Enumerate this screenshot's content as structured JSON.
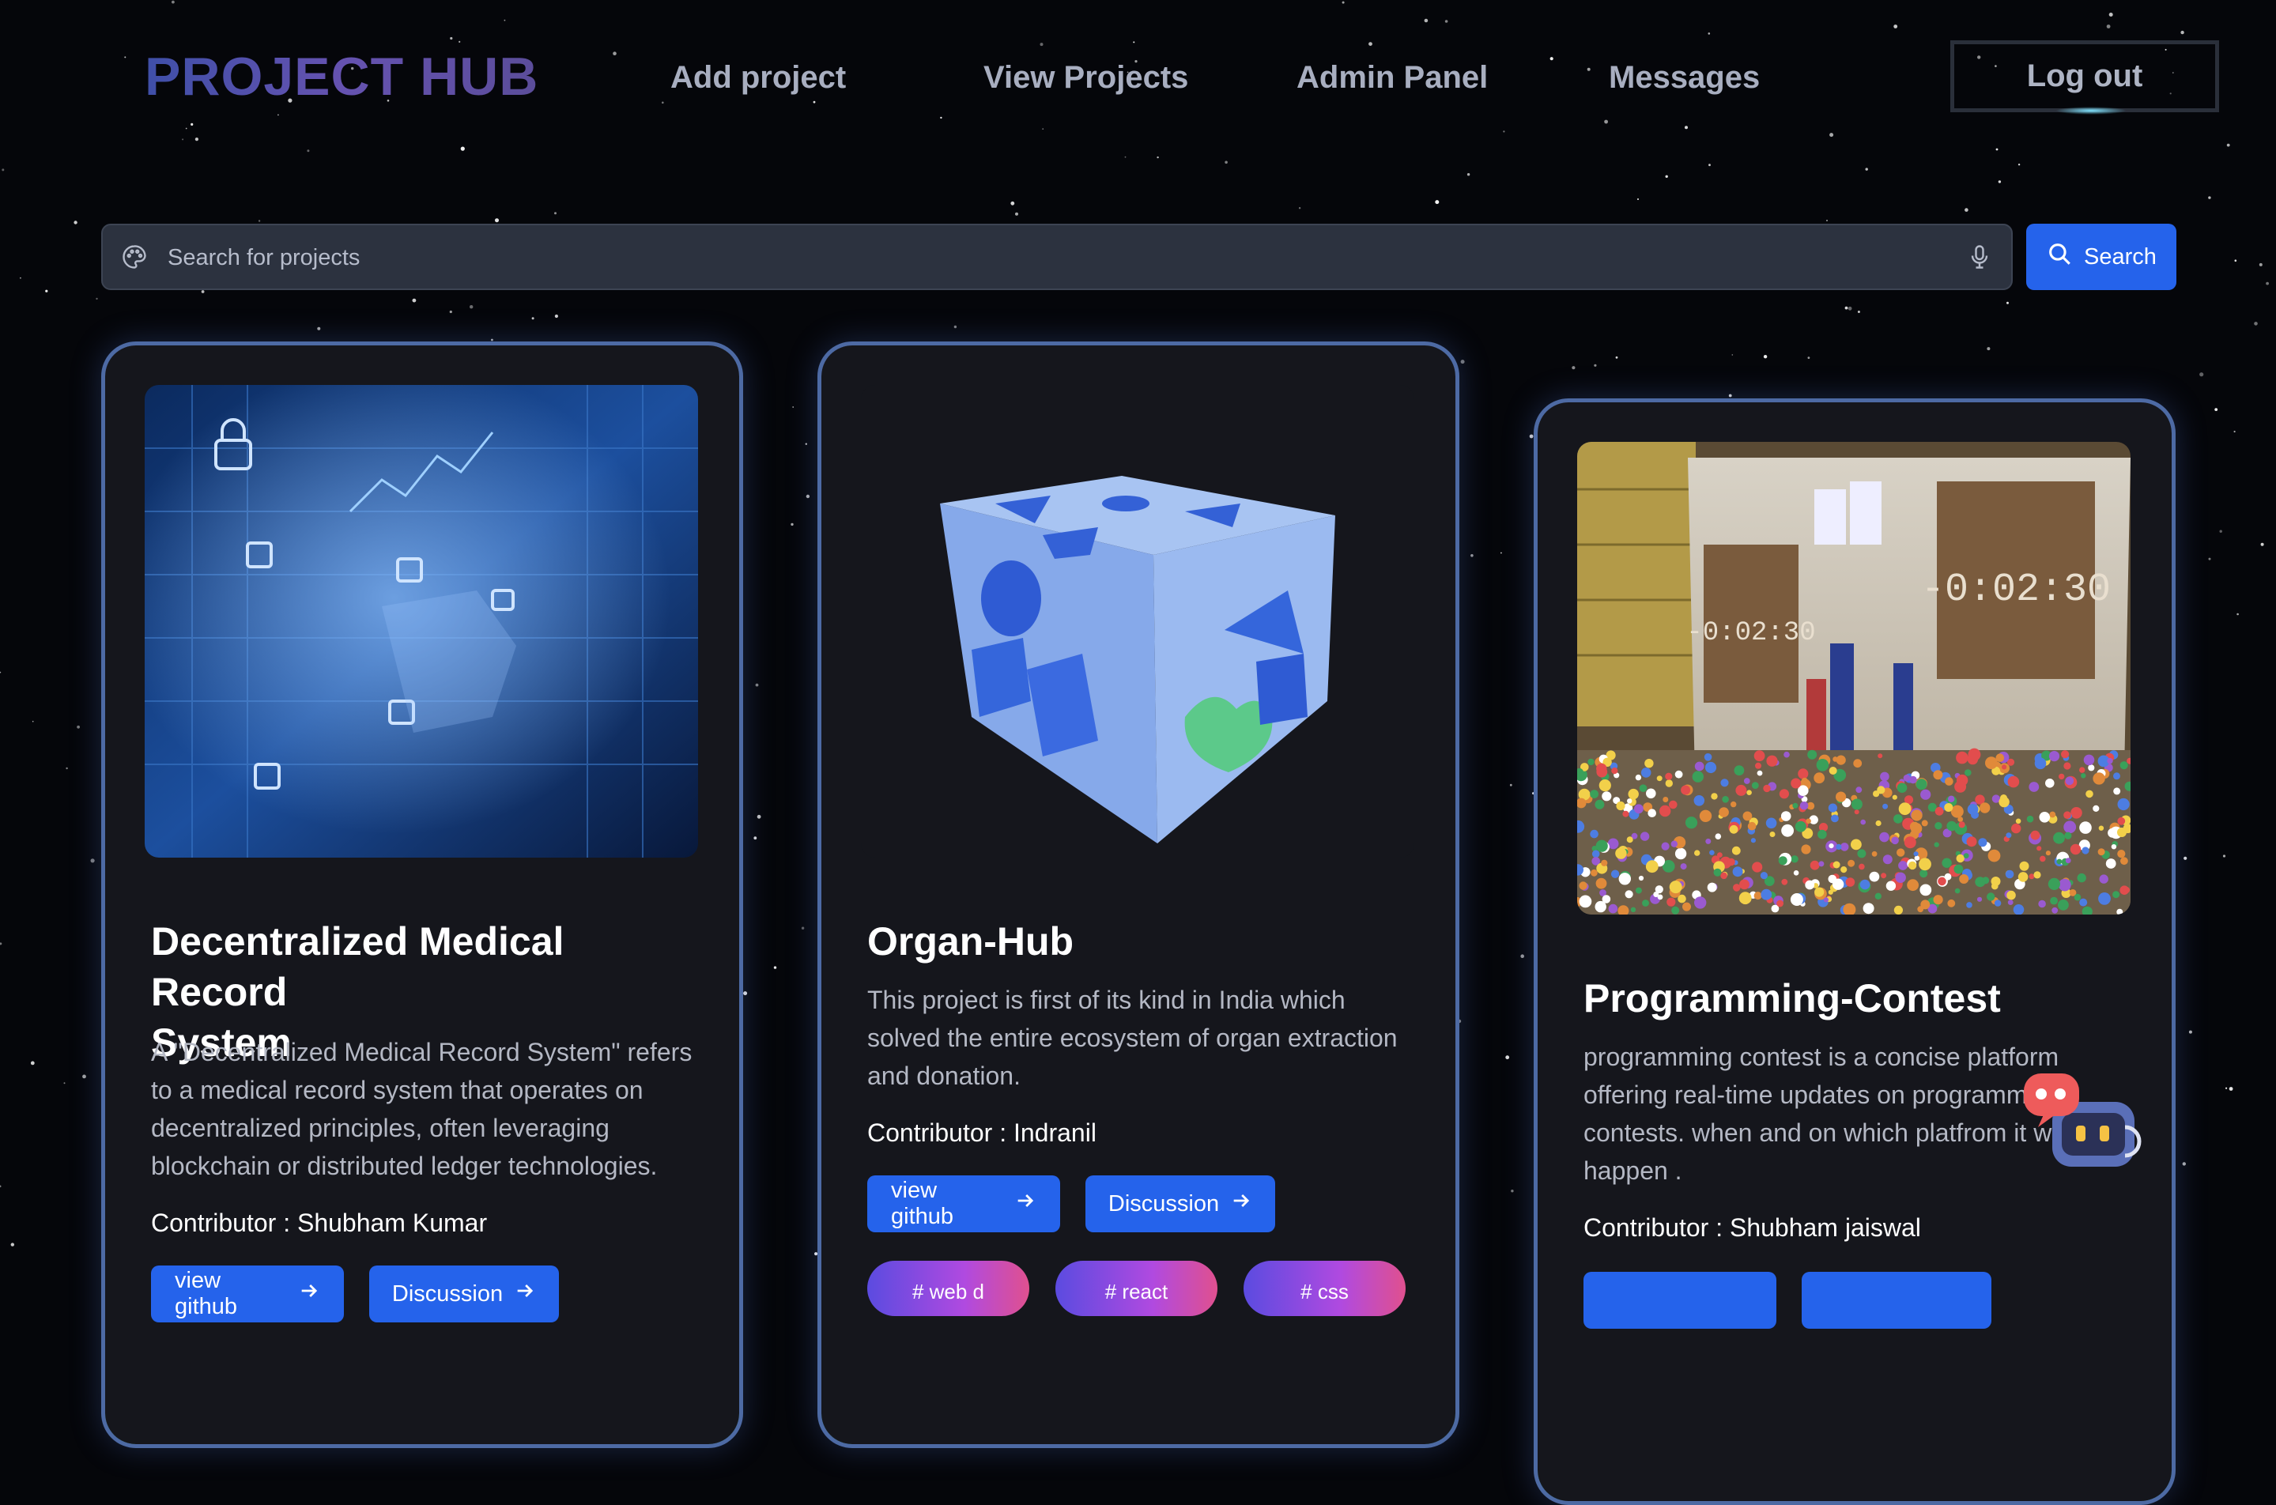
{
  "nav": {
    "brand": "PROJECT HUB",
    "links": [
      "Add project",
      "View Projects",
      "Admin Panel",
      "Messages"
    ],
    "logout": "Log out"
  },
  "search": {
    "placeholder": "Search for projects",
    "button_label": "Search"
  },
  "cards": [
    {
      "title_lines": [
        "Decentralized Medical Record",
        "System"
      ],
      "description": "A \"Decentralized Medical Record System\" refers to a medical record system that operates on decentralized principles, often leveraging blockchain or distributed ledger technologies.",
      "contributor": "Contributor : Shubham Kumar",
      "github_label": "view github",
      "discussion_label": "Discussion",
      "image": "blockchain-security-photo"
    },
    {
      "title": "Organ-Hub",
      "description": "This project is first of its kind in India which solved the entire ecosystem of organ extraction and donation.",
      "contributor": "Contributor : Indranil",
      "github_label": "view github",
      "discussion_label": "Discussion",
      "tags": [
        "# web d",
        "# react",
        "# css"
      ],
      "image": "shape-sorter-cube-3d"
    },
    {
      "title": "Programming-Contest",
      "description": "programming contest is a concise platform offering real-time updates on programming contests. when and on which platfrom it will happen .",
      "contributor": "Contributor : Shubham jaiswal",
      "timers": [
        "-0:02:30",
        "-0:02:30"
      ],
      "image": "contest-hall-photo"
    }
  ],
  "icons": [
    "palette-icon",
    "mic-icon",
    "search-icon",
    "arrow-right-icon",
    "chatbot-icon"
  ],
  "colors": {
    "accent": "#2563eb",
    "background": "#05060a",
    "card": "#15161c",
    "brand": "#4a4fa8"
  }
}
